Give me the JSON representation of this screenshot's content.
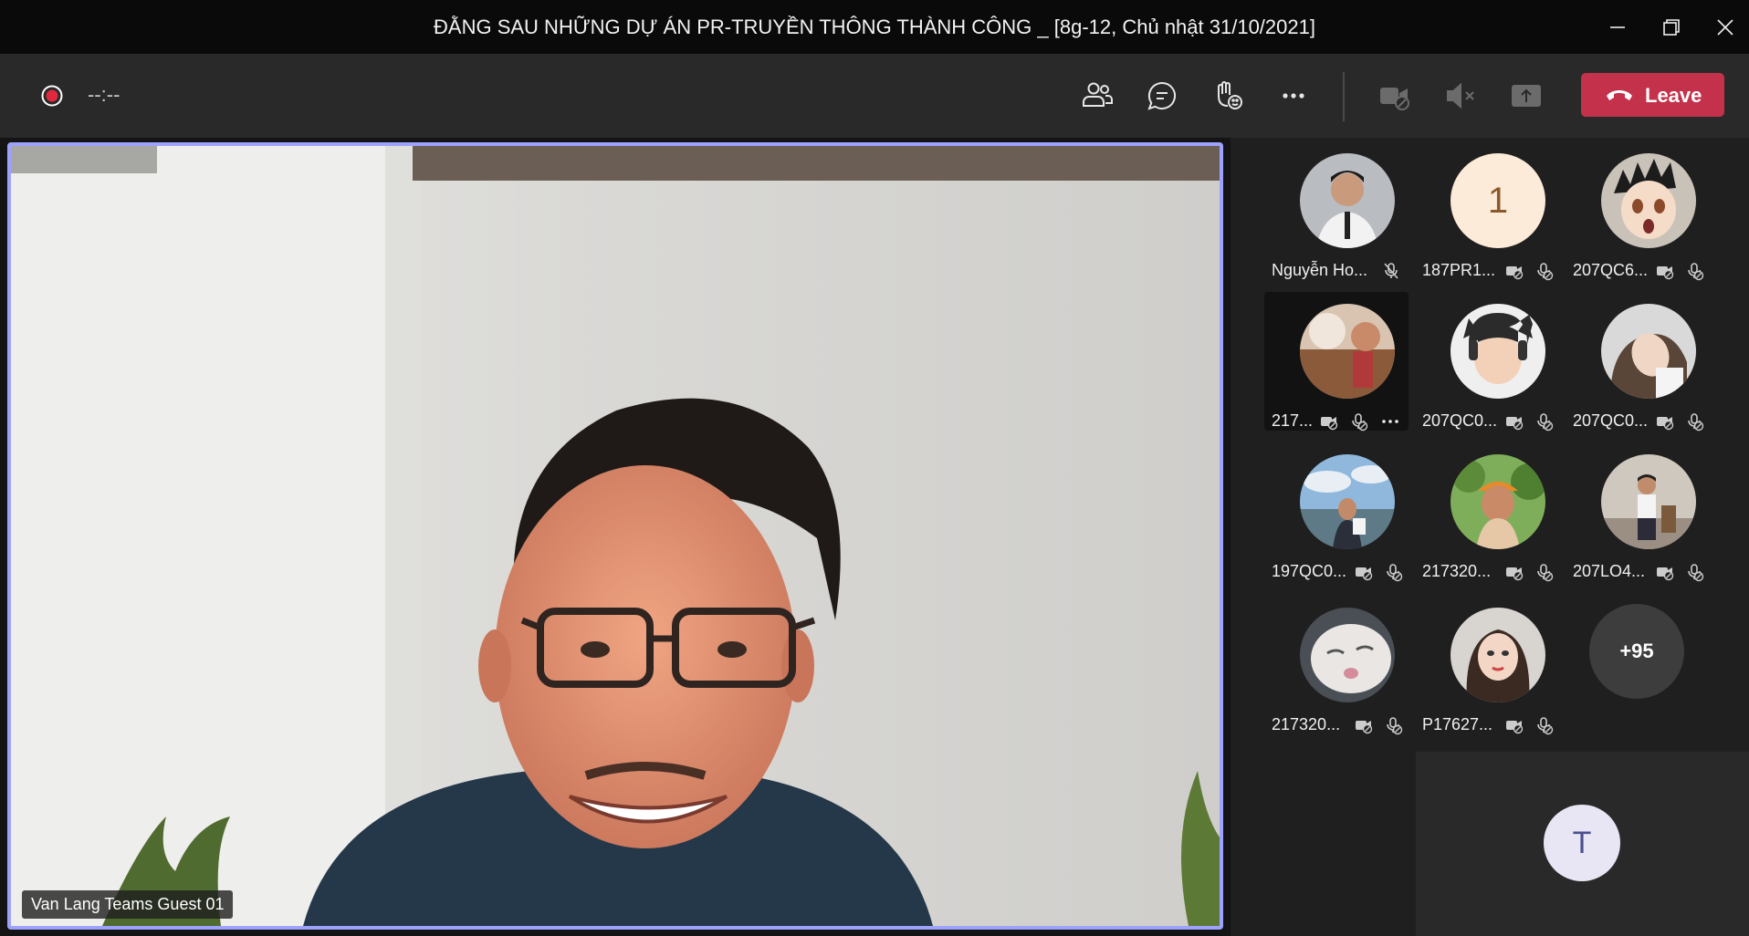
{
  "window": {
    "title": "ĐẰNG SAU NHỮNG DỰ ÁN PR-TRUYỀN THÔNG THÀNH CÔNG _ [8g-12, Chủ nhật 31/10/2021]",
    "controls": [
      "minimize-icon",
      "restore-icon",
      "close-icon"
    ]
  },
  "toolbar": {
    "recording_timer": "--:--",
    "icons": [
      "people-icon",
      "chat-icon",
      "raise-hand-icon",
      "more-actions-icon",
      "camera-off-icon",
      "mic-off-icon",
      "share-screen-icon"
    ],
    "leave_label": "Leave",
    "leave_color": "#c4314b"
  },
  "main_video": {
    "speaker_label": "Van Lang Teams Guest 01",
    "highlight_color": "#9ea2ff"
  },
  "participants": [
    {
      "name": "Nguyễn Ho...",
      "avatar": "photo",
      "status_icons": [
        "mic-off-icon"
      ]
    },
    {
      "name": "187PR1...",
      "avatar": "initial",
      "initial": "1",
      "status_icons": [
        "camera-off-icon",
        "mic-off-icon"
      ]
    },
    {
      "name": "207QC6...",
      "avatar": "photo",
      "status_icons": [
        "camera-off-icon",
        "mic-off-icon"
      ]
    },
    {
      "name": "217...",
      "avatar": "photo",
      "status_icons": [
        "camera-off-icon",
        "mic-off-icon",
        "more-options-icon"
      ]
    },
    {
      "name": "207QC0...",
      "avatar": "photo",
      "status_icons": [
        "camera-off-icon",
        "mic-off-icon"
      ]
    },
    {
      "name": "207QC0...",
      "avatar": "photo",
      "status_icons": [
        "camera-off-icon",
        "mic-off-icon"
      ]
    },
    {
      "name": "197QC0...",
      "avatar": "photo",
      "status_icons": [
        "camera-off-icon",
        "mic-off-icon"
      ]
    },
    {
      "name": "217320...",
      "avatar": "photo",
      "status_icons": [
        "camera-off-icon",
        "mic-off-icon"
      ]
    },
    {
      "name": "207LO4...",
      "avatar": "photo",
      "status_icons": [
        "camera-off-icon",
        "mic-off-icon"
      ]
    },
    {
      "name": "217320...",
      "avatar": "photo",
      "status_icons": [
        "camera-off-icon",
        "mic-off-icon"
      ]
    },
    {
      "name": "P17627...",
      "avatar": "photo",
      "status_icons": [
        "camera-off-icon",
        "mic-off-icon"
      ]
    }
  ],
  "overflow_count": "+95",
  "self_view": {
    "initial": "T"
  }
}
